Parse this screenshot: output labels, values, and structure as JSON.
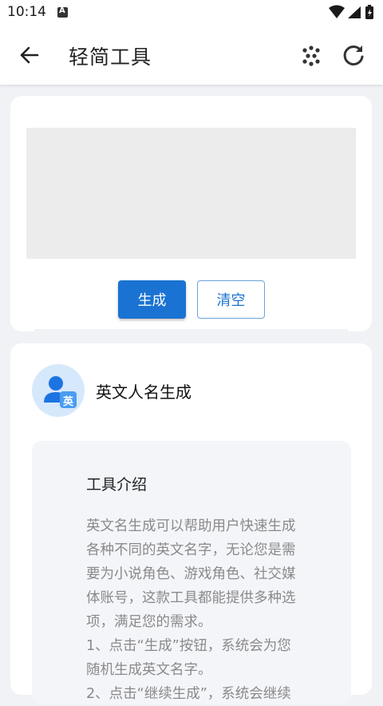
{
  "status_bar": {
    "time": "10:14",
    "indicator": "A"
  },
  "app_bar": {
    "title": "轻简工具",
    "back_icon": "arrow-back-icon",
    "grid_icon": "dots-grid-icon",
    "refresh_icon": "refresh-icon"
  },
  "generator": {
    "result_text": "",
    "generate_label": "生成",
    "clear_label": "清空"
  },
  "tool": {
    "name": "英文人名生成",
    "avatar_badge": "英",
    "intro_title": "工具介绍",
    "intro_text": "英文名生成可以帮助用户快速生成各种不同的英文名字，无论您是需要为小说角色、游戏角色、社交媒体账号，这款工具都能提供多种选项，满足您的需求。\n1、点击“生成”按钮，系统会为您随机生成英文名字。\n2、点击“继续生成”，系统会继续"
  },
  "colors": {
    "accent": "#1a73d2",
    "background": "#f1f2f6"
  }
}
